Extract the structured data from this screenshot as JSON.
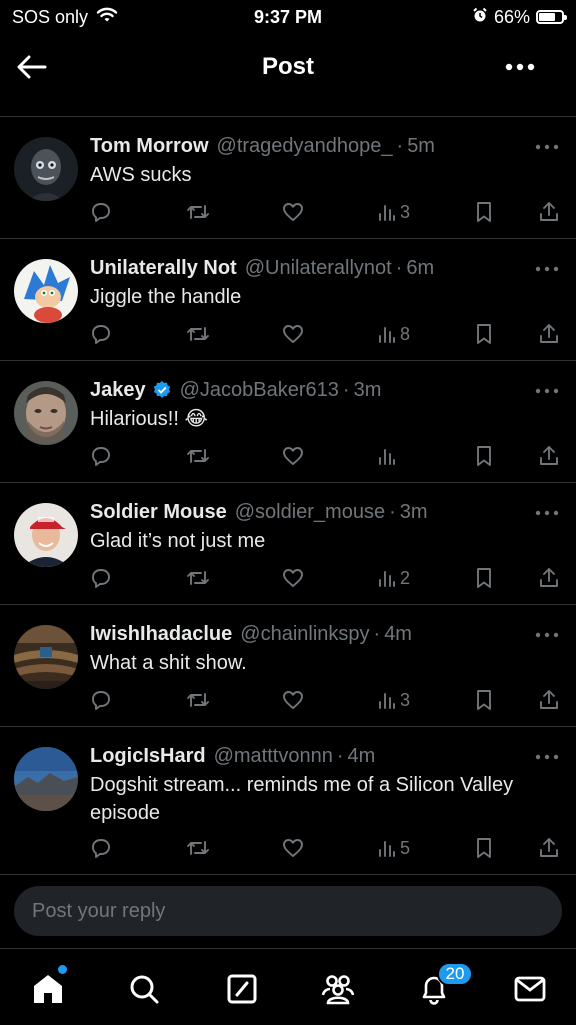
{
  "status_bar": {
    "carrier": "SOS only",
    "time": "9:37 PM",
    "battery": "66%",
    "battery_level": 0.66
  },
  "header": {
    "title": "Post"
  },
  "replies": [
    {
      "name": "Tom Morrow",
      "handle": "@tragedyandhope_",
      "sep": "·",
      "time": "5m",
      "text": "AWS sucks",
      "views": "3",
      "verified": false,
      "avatar": "dark-portrait"
    },
    {
      "name": "Unilaterally Not",
      "handle": "@Unilaterallynot",
      "sep": "·",
      "time": "6m",
      "text": "Jiggle the handle",
      "views": "8",
      "verified": false,
      "avatar": "cartoon-hedgehog"
    },
    {
      "name": "Jakey",
      "handle": "@JacobBaker613",
      "sep": "·",
      "time": "3m",
      "text": "Hilarious!! 😂",
      "views": "",
      "verified": true,
      "avatar": "face-portrait"
    },
    {
      "name": "Soldier Mouse",
      "handle": "@soldier_mouse",
      "sep": "·",
      "time": "3m",
      "text": "Glad it’s not just me",
      "views": "2",
      "verified": false,
      "avatar": "red-cap-man"
    },
    {
      "name": "IwishIhadaclue",
      "handle": "@chainlinkspy",
      "sep": "·",
      "time": "4m",
      "text": "What a shit show.",
      "views": "3",
      "verified": false,
      "avatar": "chamber-room"
    },
    {
      "name": "LogicIsHard",
      "handle": "@matttvonnn",
      "sep": "·",
      "time": "4m",
      "text": "Dogshit stream... reminds me of a Silicon Valley episode",
      "views": "5",
      "verified": false,
      "avatar": "mountain-sky"
    }
  ],
  "reply_box": {
    "placeholder": "Post your reply"
  },
  "tabbar": {
    "notifications_count": "20"
  },
  "colors": {
    "accent": "#1d9bf0",
    "muted": "#71767b",
    "divider": "#2f3336",
    "background": "#000000"
  }
}
